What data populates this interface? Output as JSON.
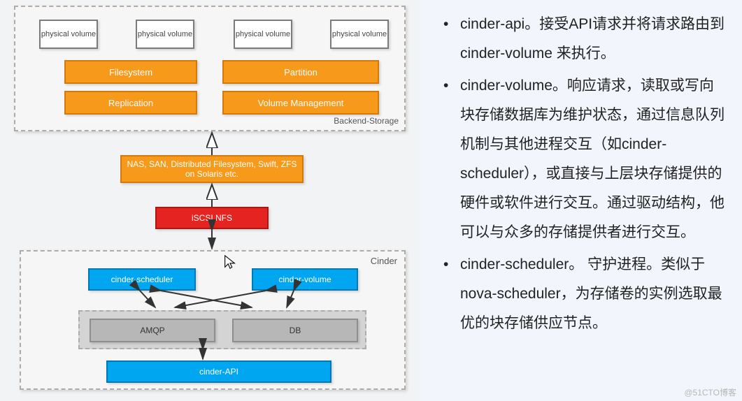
{
  "diagram": {
    "backend_storage": {
      "label": "Backend-Storage",
      "physical_volumes": [
        "physical volume",
        "physical volume",
        "physical volume",
        "physical volume"
      ],
      "filesystem": "Filesystem",
      "replication": "Replication",
      "partition": "Partition",
      "volume_management": "Volume Management"
    },
    "middle": {
      "nas": "NAS, SAN, Distributed Filesystem, Swift, ZFS on Solaris etc.",
      "iscsi": "iSCSI,NFS"
    },
    "cinder": {
      "label": "Cinder",
      "scheduler": "cinder-scheduler",
      "volume": "cinder-volume",
      "amqp": "AMQP",
      "db": "DB",
      "api": "cinder-API"
    }
  },
  "bullets": {
    "b1": "cinder-api。接受API请求并将请求路由到 cinder-volume 来执行。",
    "b2": "cinder-volume。响应请求，读取或写向块存储数据库为维护状态，通过信息队列机制与其他进程交互（如cinder-scheduler），或直接与上层块存储提供的硬件或软件进行交互。通过驱动结构，他可以与众多的存储提供者进行交互。",
    "b3": "cinder-scheduler。 守护进程。类似于nova-scheduler，为存储卷的实例选取最优的块存储供应节点。"
  },
  "watermark": "@51CTO博客"
}
